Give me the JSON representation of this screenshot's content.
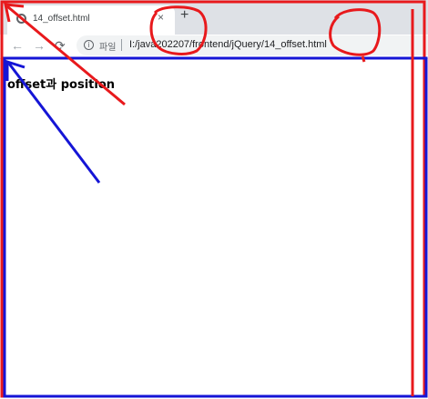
{
  "browser": {
    "tab": {
      "title": "14_offset.html",
      "close_glyph": "×"
    },
    "new_tab_glyph": "+",
    "nav": {
      "back": "←",
      "forward": "→",
      "reload": "⟳"
    },
    "address": {
      "info_glyph": "i",
      "security_chip": "파일",
      "url": "I:/java202207/frontend/jQuery/14_offset.html"
    }
  },
  "page": {
    "heading": "offset과 position"
  },
  "colors": {
    "annotation_red": "#e8191c",
    "annotation_blue": "#1515d6"
  },
  "icons": [
    "page-icon",
    "close-icon",
    "plus-icon",
    "back-arrow-icon",
    "forward-arrow-icon",
    "reload-icon",
    "info-icon"
  ]
}
